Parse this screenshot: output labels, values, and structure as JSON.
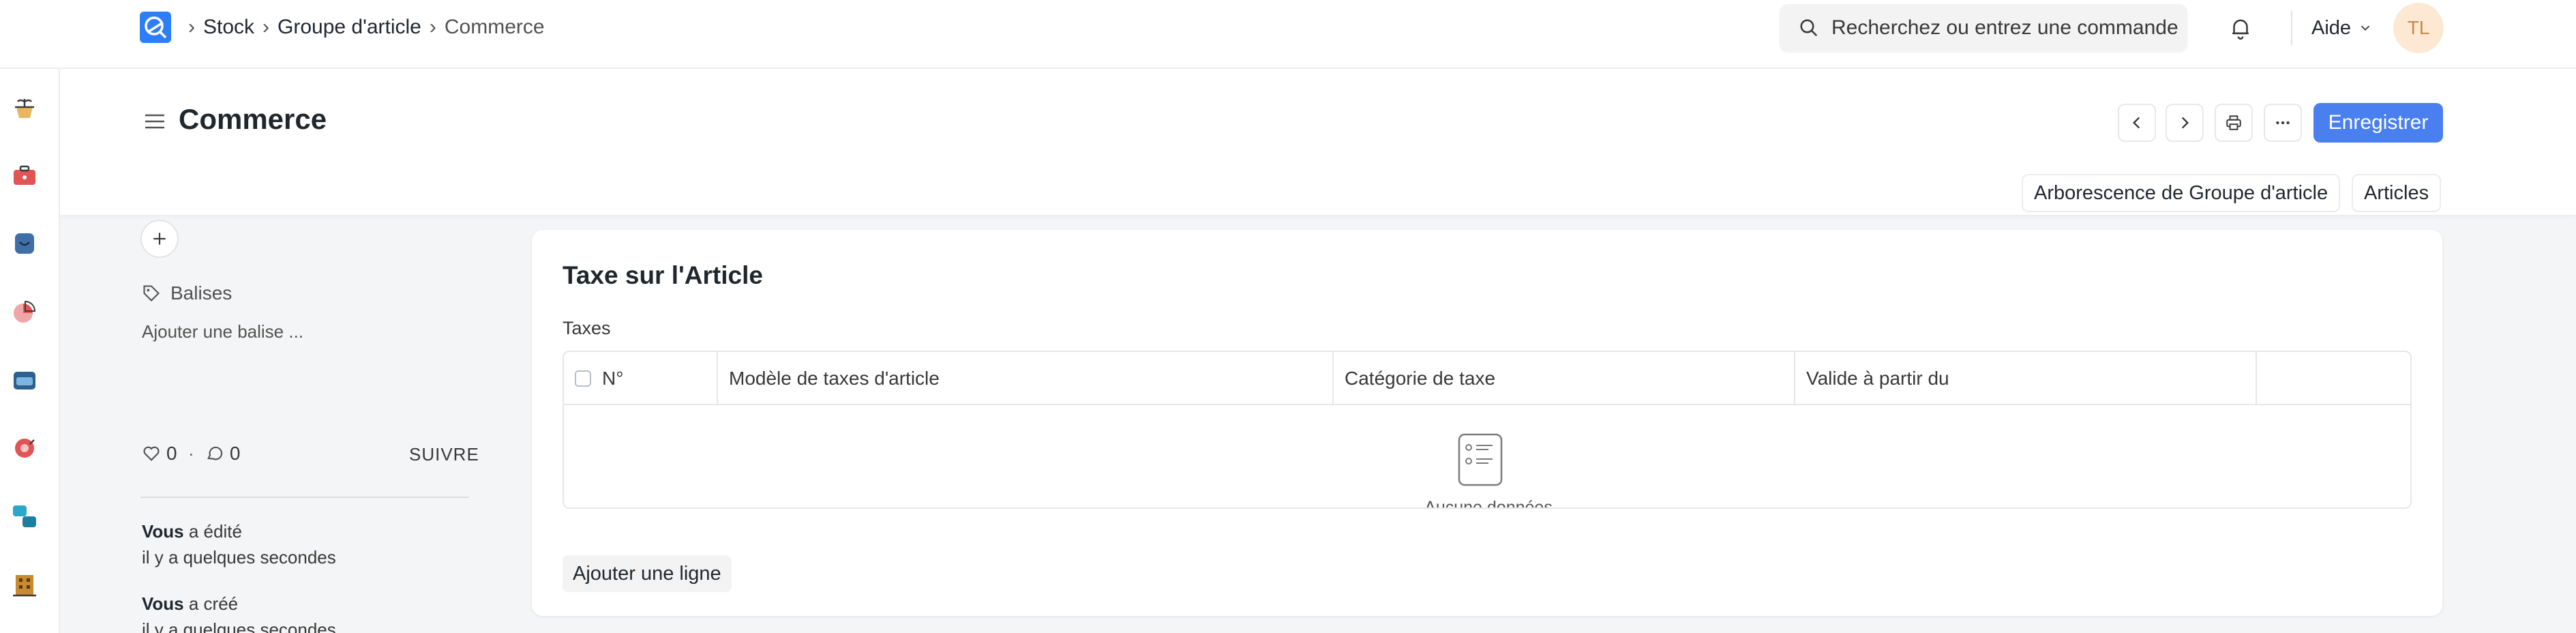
{
  "navbar": {
    "breadcrumbs": [
      "Stock",
      "Groupe d'article",
      "Commerce"
    ],
    "search_placeholder": "Recherchez ou entrez une commande",
    "help_label": "Aide",
    "avatar_initials": "TL"
  },
  "sidebar_rail": {
    "icons": [
      "plant-pot-icon",
      "briefcase-icon",
      "shield-icon",
      "pie-chart-icon",
      "inbox-icon",
      "support-icon",
      "linked-boxes-icon",
      "building-icon"
    ]
  },
  "page": {
    "title": "Commerce",
    "save_label": "Enregistrer",
    "tree_button_label": "Arborescence de Groupe d'article",
    "items_button_label": "Articles"
  },
  "sidebar": {
    "tags_label": "Balises",
    "add_tag_label": "Ajouter une balise ...",
    "likes": "0",
    "comments": "0",
    "dot": "·",
    "follow_label": "SUIVRE",
    "activity": [
      {
        "actor": "Vous",
        "action": "a édité",
        "time": "il y a quelques secondes"
      },
      {
        "actor": "Vous",
        "action": "a créé",
        "time": "il y a quelques secondes"
      }
    ]
  },
  "card": {
    "title": "Taxe sur l'Article",
    "field_label": "Taxes",
    "columns": [
      "N°",
      "Modèle de taxes d'article",
      "Catégorie de taxe",
      "Valide à partir du"
    ],
    "empty_text": "Aucune données",
    "add_row_label": "Ajouter une ligne"
  },
  "colors": {
    "primary": "#4a7ff0",
    "logo": "#2d7ff9"
  }
}
